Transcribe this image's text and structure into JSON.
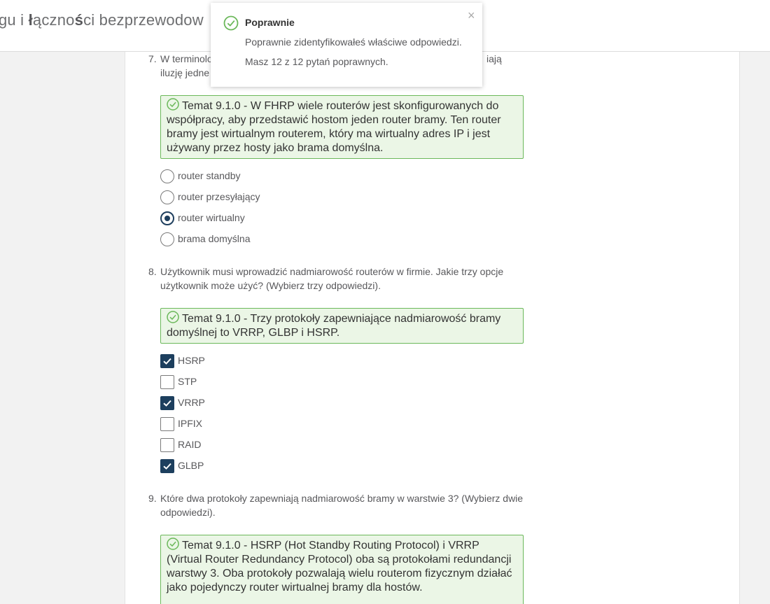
{
  "header": {
    "title_parts": [
      "gu i ",
      "ł",
      "ączno",
      "ś",
      "ci bezprzewodow"
    ]
  },
  "toast": {
    "title": "Poprawnie",
    "message": "Poprawnie zidentyfikowałeś właściwe odpowiedzi.",
    "score": "Masz 12 z 12 pytań poprawnych.",
    "close": "×",
    "accent_color": "#6bb85a"
  },
  "questions": [
    {
      "number": "7.",
      "text": "W terminologii FHRP, które urządzenia, zespół routerów tworzący iluzję jedne",
      "visible_text_left": "W terminolo",
      "visible_text_line2": "iluzję jedne",
      "visible_text_right": "iają",
      "feedback": "Temat 9.1.0 - W FHRP wiele routerów jest skonfigurowanych do współpracy, aby przedstawić hostom jeden router bramy. Ten router bramy jest wirtualnym routerem, który ma wirtualny adres IP i jest używany przez hosty jako brama domyślna.",
      "type": "radio",
      "options": [
        {
          "label": "router standby",
          "selected": false
        },
        {
          "label": "router przesyłający",
          "selected": false
        },
        {
          "label": "router wirtualny",
          "selected": true
        },
        {
          "label": "brama domyślna",
          "selected": false
        }
      ]
    },
    {
      "number": "8.",
      "text": "Użytkownik musi wprowadzić nadmiarowość routerów w firmie. Jakie trzy opcje użytkownik może użyć? (Wybierz trzy odpowiedzi).",
      "feedback": "Temat 9.1.0 - Trzy protokoły zapewniające nadmiarowość bramy domyślnej to VRRP, GLBP i HSRP.",
      "type": "checkbox",
      "options": [
        {
          "label": "HSRP",
          "selected": true
        },
        {
          "label": "STP",
          "selected": false
        },
        {
          "label": "VRRP",
          "selected": true
        },
        {
          "label": "IPFIX",
          "selected": false
        },
        {
          "label": "RAID",
          "selected": false
        },
        {
          "label": "GLBP",
          "selected": true
        }
      ]
    },
    {
      "number": "9.",
      "text": "Które dwa protokoły zapewniają nadmiarowość bramy w warstwie 3? (Wybierz dwie odpowiedzi).",
      "feedback": "Temat 9.1.0 - HSRP (Hot Standby Routing Protocol) i VRRP (Virtual Router Redundancy Protocol) oba są protokołami redundancji warstwy 3. Oba protokoły pozwalają wielu routerom fizycznym działać jako pojedynczy router wirtualnej bramy dla hostów."
    }
  ]
}
